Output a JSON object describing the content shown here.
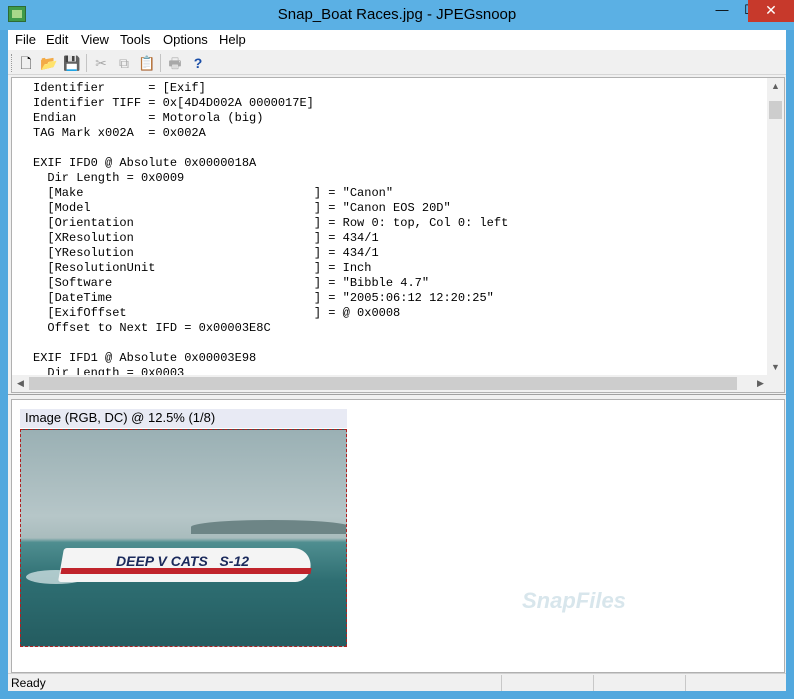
{
  "window": {
    "title": "Snap_Boat Races.jpg - JPEGsnoop",
    "controls": {
      "minimize": "—",
      "maximize": "☐",
      "close": "✕"
    }
  },
  "menubar": {
    "items": [
      "File",
      "Edit",
      "View",
      "Tools",
      "Options",
      "Help"
    ]
  },
  "toolbar": {
    "buttons": [
      {
        "icon": "new-file-icon",
        "glyph": "🗋"
      },
      {
        "icon": "open-folder-icon",
        "glyph": "📂"
      },
      {
        "icon": "save-icon",
        "glyph": "💾"
      },
      {
        "icon": "cut-icon",
        "glyph": "✂"
      },
      {
        "icon": "copy-icon",
        "glyph": "⧉"
      },
      {
        "icon": "paste-icon",
        "glyph": "📋"
      },
      {
        "icon": "print-icon",
        "glyph": "🖶"
      },
      {
        "icon": "help-icon",
        "glyph": "?"
      }
    ]
  },
  "log": {
    "lines": [
      "Identifier      = [Exif]",
      "Identifier TIFF = 0x[4D4D002A 0000017E]",
      "Endian          = Motorola (big)",
      "TAG Mark x002A  = 0x002A",
      "",
      "EXIF IFD0 @ Absolute 0x0000018A",
      "  Dir Length = 0x0009",
      "  [Make                                ] = \"Canon\"",
      "  [Model                               ] = \"Canon EOS 20D\"",
      "  [Orientation                         ] = Row 0: top, Col 0: left",
      "  [XResolution                         ] = 434/1",
      "  [YResolution                         ] = 434/1",
      "  [ResolutionUnit                      ] = Inch",
      "  [Software                            ] = \"Bibble 4.7\"",
      "  [DateTime                            ] = \"2005:06:12 12:20:25\"",
      "  [ExifOffset                          ] = @ 0x0008",
      "  Offset to Next IFD = 0x00003E8C",
      "",
      "EXIF IFD1 @ Absolute 0x00003E98",
      "  Dir Length = 0x0003"
    ]
  },
  "image_view": {
    "header": "Image (RGB, DC) @ 12.5% (1/8)",
    "boat_label": "DEEP V CATS   S-12",
    "watermark": "SnapFiles"
  },
  "statusbar": {
    "text": "Ready"
  }
}
